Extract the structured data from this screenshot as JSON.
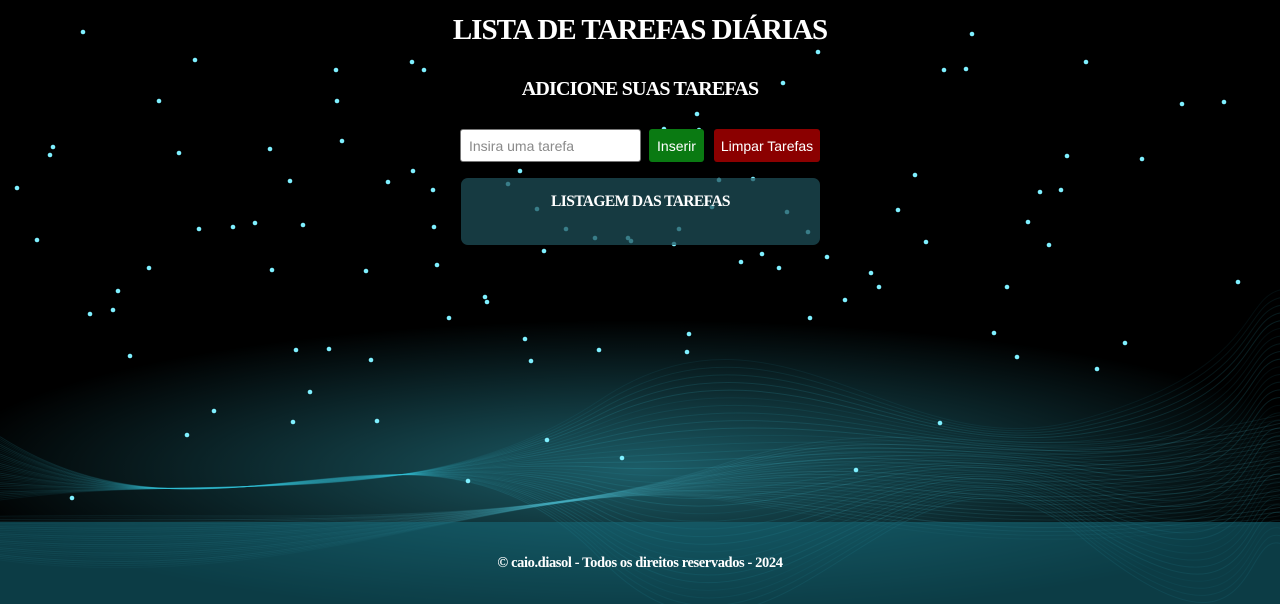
{
  "page": {
    "title": "LISTA DE TAREFAS DIÁRIAS",
    "subtitle": "ADICIONE SUAS TAREFAS"
  },
  "form": {
    "input_placeholder": "Insira uma tarefa",
    "input_value": "",
    "insert_label": "Inserir",
    "clear_label": "Limpar Tarefas"
  },
  "list": {
    "title": "LISTAGEM DAS TAREFAS",
    "items": []
  },
  "footer": {
    "text": "© caio.diasol - Todos os direitos reservados - 2024"
  },
  "colors": {
    "background": "#000000",
    "accent_cyan": "#2ec5dc",
    "insert_button": "#0a7a12",
    "clear_button": "#8b0000",
    "panel": "#1e505a",
    "footer": "#166e7d"
  },
  "background_image": "digital-cyan-light-lines-and-waves"
}
